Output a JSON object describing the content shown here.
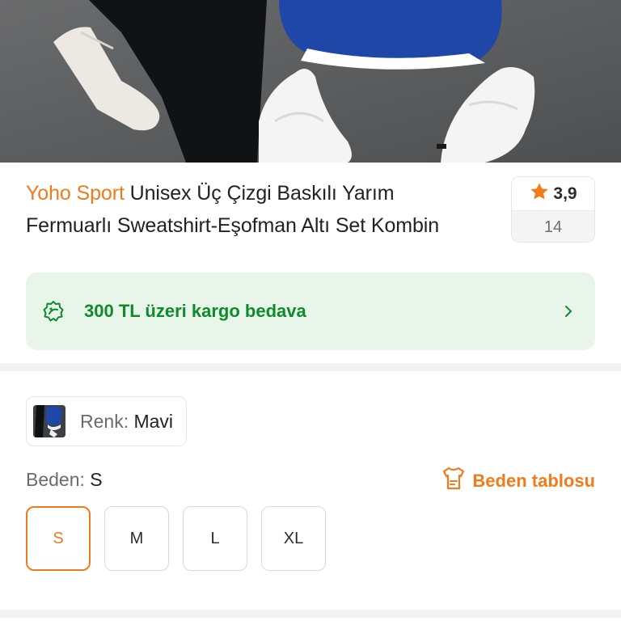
{
  "product": {
    "brand": "Yoho Sport",
    "title_line1_rest": " Unisex Üç Çizgi Baskılı Yarım",
    "title_line2": "Fermuarlı Sweatshirt-Eşofman Altı Set Kombin"
  },
  "rating": {
    "score": "3,9",
    "count": "14",
    "star_icon": "star-icon",
    "star_color": "#f27a1a"
  },
  "shipping": {
    "text": "300 TL üzeri kargo bedava",
    "icon": "discount-badge-icon",
    "text_color": "#0f8a2c",
    "background": "#e8f6e9"
  },
  "color": {
    "label": "Renk:",
    "value": "Mavi"
  },
  "size": {
    "label": "Beden:",
    "selected": "S",
    "chart_label": "Beden tablosu",
    "chart_icon": "size-chart-icon",
    "options": [
      "S",
      "M",
      "L",
      "XL"
    ]
  },
  "theme": {
    "accent": "#f27a1a"
  }
}
